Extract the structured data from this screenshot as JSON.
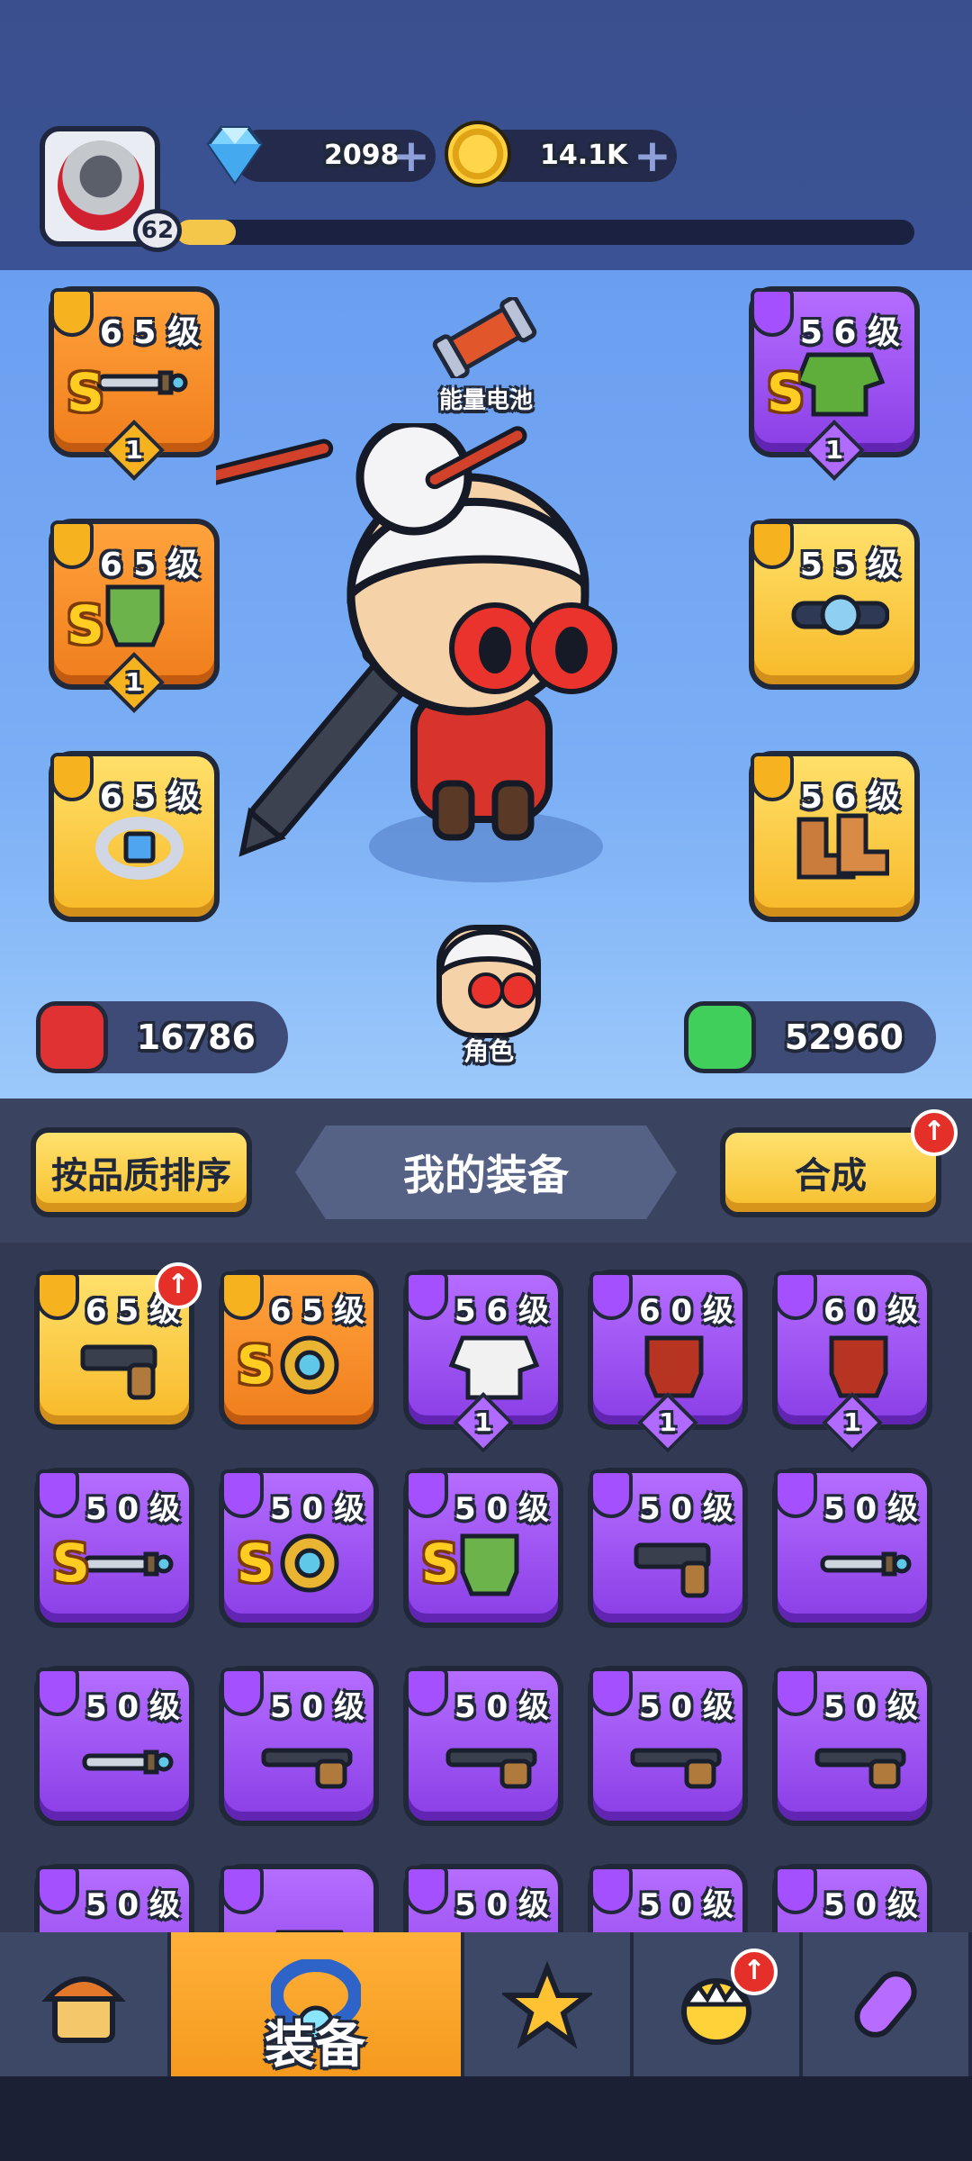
{
  "player": {
    "level": "62",
    "xp_progress": 0.08
  },
  "currency": {
    "gems": {
      "value": "2098",
      "icon": "diamond-icon"
    },
    "coins": {
      "value": "14.1K",
      "icon": "coin-icon"
    },
    "add_symbol": "+"
  },
  "equipped": {
    "battery_label": "能量电池",
    "left": [
      {
        "level": "6 5 级",
        "grade": "S",
        "rank": "1",
        "rarity": "orange",
        "item": "dagger-icon",
        "slot": "weapon-slot-icon"
      },
      {
        "level": "6 5 级",
        "grade": "S",
        "rank": "1",
        "rarity": "orange",
        "item": "gauntlet-icon",
        "slot": "glove-slot-icon"
      },
      {
        "level": "6 5 级",
        "grade": "",
        "rank": "",
        "rarity": "yellow",
        "item": "ring-icon",
        "slot": "ring-slot-icon"
      }
    ],
    "right": [
      {
        "level": "5 6 级",
        "grade": "S",
        "rank": "1",
        "rarity": "purple",
        "item": "armor-icon",
        "slot": "armor-slot-icon"
      },
      {
        "level": "5 5 级",
        "grade": "",
        "rank": "",
        "rarity": "yellow",
        "item": "belt-icon",
        "slot": "belt-slot-icon"
      },
      {
        "level": "5 6 级",
        "grade": "",
        "rank": "",
        "rarity": "yellow",
        "item": "boots-icon",
        "slot": "boots-slot-icon"
      }
    ],
    "character_tab": "角色"
  },
  "stats": {
    "attack": "16786",
    "health": "52960"
  },
  "inventory": {
    "sort_button": "按品质排序",
    "title": "我的装备",
    "merge_button": "合成",
    "upgrade_symbol": "↑",
    "items": [
      {
        "level": "6 5 级",
        "grade": "",
        "rank": "",
        "rarity": "yellow",
        "item": "pistol-icon",
        "upgrade": true
      },
      {
        "level": "6 5 级",
        "grade": "S",
        "rank": "",
        "rarity": "orange",
        "item": "amulet-icon",
        "upgrade": false
      },
      {
        "level": "5 6 级",
        "grade": "",
        "rank": "1",
        "rarity": "purple",
        "item": "robe-icon",
        "upgrade": false
      },
      {
        "level": "6 0 级",
        "grade": "",
        "rank": "1",
        "rarity": "purple",
        "item": "claw-icon",
        "upgrade": false
      },
      {
        "level": "6 0 级",
        "grade": "",
        "rank": "1",
        "rarity": "purple",
        "item": "claw-icon",
        "upgrade": false
      },
      {
        "level": "5 0 级",
        "grade": "S",
        "rank": "",
        "rarity": "purple",
        "item": "dagger-icon",
        "upgrade": false
      },
      {
        "level": "5 0 级",
        "grade": "S",
        "rank": "",
        "rarity": "purple",
        "item": "amulet-icon",
        "upgrade": false
      },
      {
        "level": "5 0 级",
        "grade": "S",
        "rank": "",
        "rarity": "purple",
        "item": "gauntlet-icon",
        "upgrade": false
      },
      {
        "level": "5 0 级",
        "grade": "",
        "rank": "",
        "rarity": "purple",
        "item": "pistol-icon",
        "upgrade": false
      },
      {
        "level": "5 0 级",
        "grade": "",
        "rank": "",
        "rarity": "purple",
        "item": "knife-icon",
        "upgrade": false
      },
      {
        "level": "5 0 级",
        "grade": "",
        "rank": "",
        "rarity": "purple",
        "item": "knife-icon",
        "upgrade": false
      },
      {
        "level": "5 0 级",
        "grade": "",
        "rank": "",
        "rarity": "purple",
        "item": "crossbow-icon",
        "upgrade": false
      },
      {
        "level": "5 0 级",
        "grade": "",
        "rank": "",
        "rarity": "purple",
        "item": "shotgun-icon",
        "upgrade": false
      },
      {
        "level": "5 0 级",
        "grade": "",
        "rank": "",
        "rarity": "purple",
        "item": "shotgun-icon",
        "upgrade": false
      },
      {
        "level": "5 0 级",
        "grade": "",
        "rank": "",
        "rarity": "purple",
        "item": "shotgun-icon",
        "upgrade": false
      },
      {
        "level": "5 0 级",
        "grade": "",
        "rank": "",
        "rarity": "purple",
        "item": "pistol-icon",
        "upgrade": false
      },
      {
        "level": "",
        "grade": "",
        "rank": "",
        "rarity": "purple",
        "item": "armor-icon",
        "upgrade": false
      },
      {
        "level": "5 0 级",
        "grade": "",
        "rank": "",
        "rarity": "purple",
        "item": "belt-icon",
        "upgrade": false
      },
      {
        "level": "5 0 级",
        "grade": "",
        "rank": "",
        "rarity": "purple",
        "item": "belt-icon",
        "upgrade": false
      },
      {
        "level": "5 0 级",
        "grade": "",
        "rank": "",
        "rarity": "purple",
        "item": "belt-icon",
        "upgrade": false
      }
    ]
  },
  "nav": {
    "active_label": "装备",
    "items": [
      {
        "icon": "shop-icon",
        "badge": false
      },
      {
        "icon": "ring-icon",
        "badge": false
      },
      {
        "icon": "star-weapons-icon",
        "badge": false
      },
      {
        "icon": "pet-egg-icon",
        "badge": true
      },
      {
        "icon": "capsule-icon",
        "badge": false
      }
    ]
  },
  "colors": {
    "orange": "#f07d1c",
    "purple": "#8a3ee6",
    "yellow": "#f7b928",
    "attack": "#e03232",
    "health": "#3fcf5a"
  }
}
